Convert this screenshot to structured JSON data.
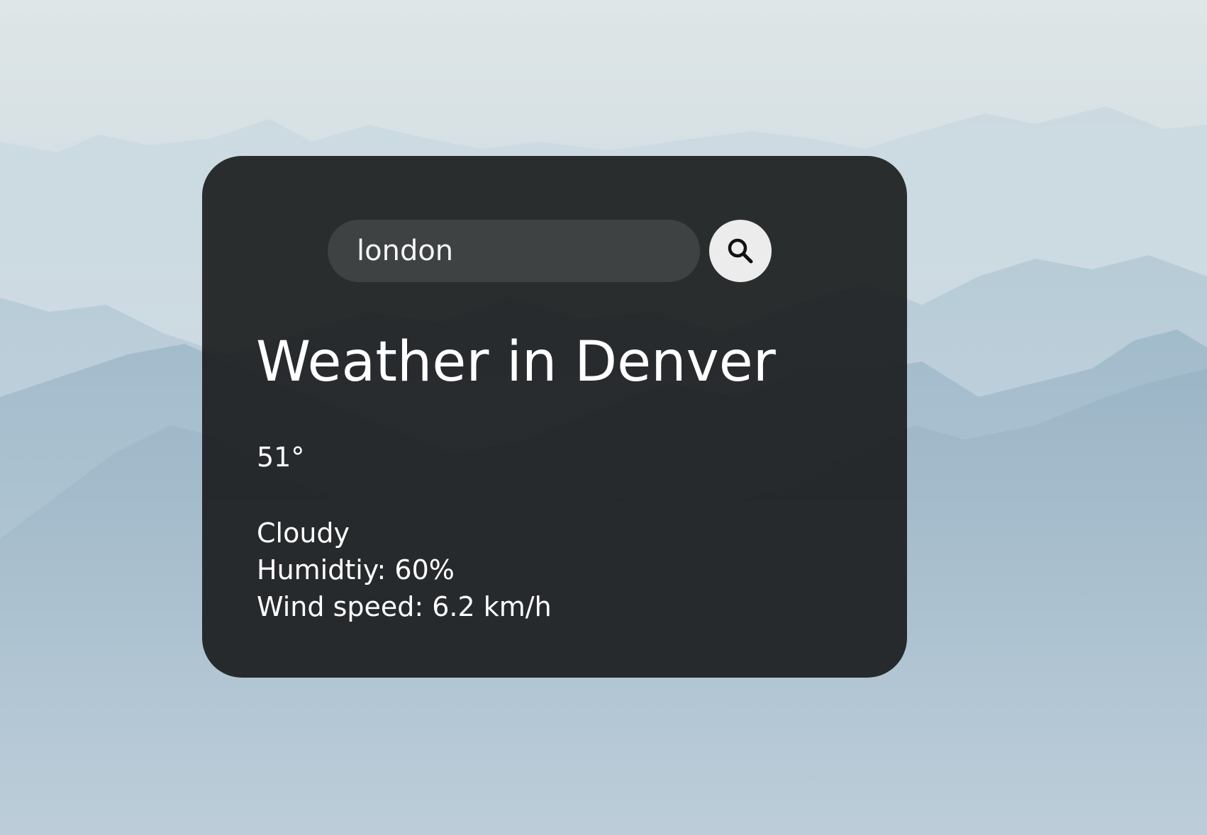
{
  "background": {
    "description_colors": {
      "sky": "#dfe6e7",
      "mountain": "#8aa9bd",
      "mountain_dark": "#6a8ea6"
    }
  },
  "search": {
    "value": "london",
    "button_icon": "search-icon"
  },
  "weather": {
    "title": "Weather in Denver",
    "temperature": "51°",
    "condition": "Cloudy",
    "humidity": "Humidtiy: 60%",
    "wind": "Wind speed: 6.2 km/h"
  },
  "colors": {
    "card": "#18191b",
    "text": "#ffffff",
    "button": "#ececec"
  }
}
